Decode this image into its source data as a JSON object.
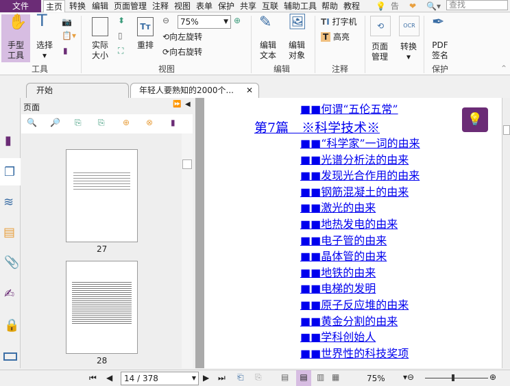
{
  "menu": {
    "file": "文件",
    "items": [
      "主页",
      "转换",
      "编辑",
      "页面管理",
      "注释",
      "视图",
      "表单",
      "保护",
      "共享",
      "互联",
      "辅助工具",
      "帮助",
      "教程"
    ],
    "tell": "告诉",
    "search_placeholder": "查找"
  },
  "ribbon": {
    "hand": "手型\n工具",
    "select": "选择",
    "tools_group": "工具",
    "actual_size": "实际\n大小",
    "reflow": "重排",
    "zoom": "75%",
    "rotate_left": "向左旋转",
    "rotate_right": "向右旋转",
    "view_group": "视图",
    "edit_text": "编辑\n文本",
    "edit_object": "编辑\n对象",
    "edit_group": "编辑",
    "typewriter": "打字机",
    "highlight": "高亮",
    "comment_group": "注释",
    "page_manage": "页面\n管理",
    "convert": "转换",
    "pdf_sign": "PDF\n签名",
    "protect_group": "保护"
  },
  "tabs": {
    "start": "开始",
    "doc": "年轻人要熟知的2000个..."
  },
  "panel": {
    "title": "页面",
    "thumb_labels": [
      "27",
      "28"
    ]
  },
  "document": {
    "top_link": "■■何谓“五伦五常”",
    "heading": "第7篇　※科学技术※",
    "links": [
      "■■“科学家”一词的由来",
      "■■光谱分析法的由来",
      "■■发现光合作用的由来",
      "■■钢筋混凝土的由来",
      "■■激光的由来",
      "■■地热发电的由来",
      "■■电子管的由来",
      "■■晶体管的由来",
      "■■地铁的由来",
      "■■电梯的发明",
      "■■原子反应堆的由来",
      "■■黄金分割的由来",
      "■■学科创始人",
      "■■世界性的科技奖项"
    ]
  },
  "status": {
    "page": "14 / 378",
    "zoom": "75%",
    "zoom_slider_fraction": 0.45
  },
  "colors": {
    "brand": "#6b2c76",
    "link": "#0000ee",
    "active": "#d7bde2"
  }
}
